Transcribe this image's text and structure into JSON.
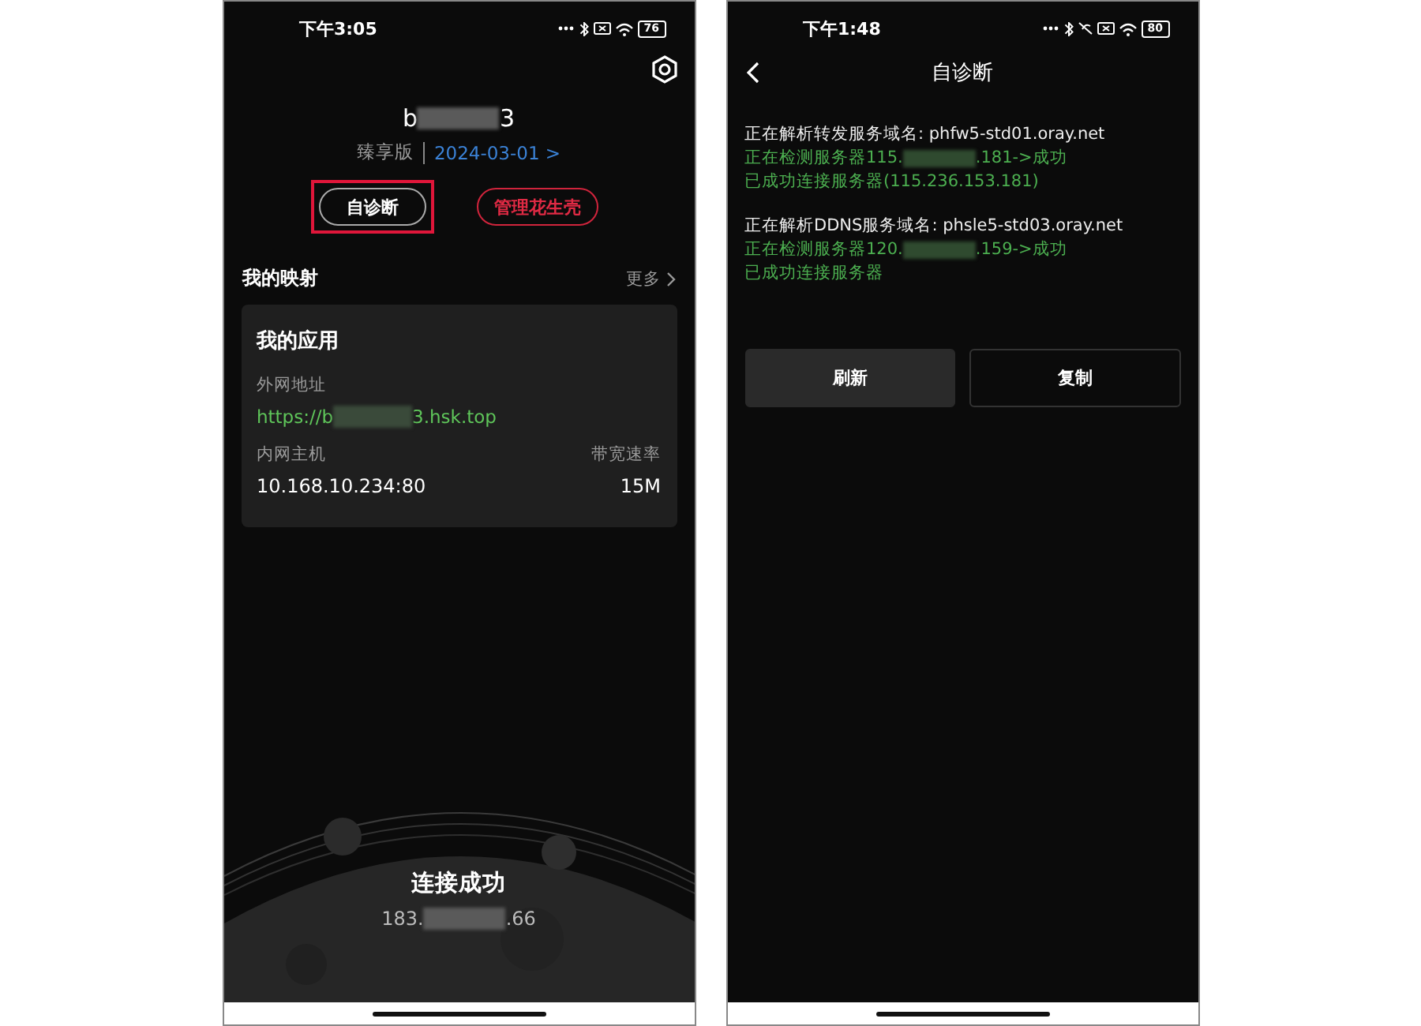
{
  "left_screen": {
    "status_bar": {
      "time": "下午3:05",
      "battery": "76"
    },
    "account": {
      "name_parts": [
        "b",
        "3"
      ],
      "edition": "臻享版",
      "expiry": "2024-03-01 >"
    },
    "buttons": [
      {
        "label": "自诊断",
        "kind": "outline",
        "highlighted": true
      },
      {
        "label": "管理花生壳",
        "kind": "danger",
        "highlighted": false
      }
    ],
    "section": {
      "title": "我的映射",
      "more": "更多"
    },
    "card": {
      "title": "我的应用",
      "url_label": "外网地址",
      "url_parts": [
        "https://b",
        "3.hsk.top"
      ],
      "host_label": "内网主机",
      "host": "10.168.10.234:80",
      "bandwidth_label": "带宽速率",
      "bandwidth": "15M"
    },
    "connection": {
      "status": "连接成功",
      "ip_parts": [
        "183.",
        ".66"
      ]
    }
  },
  "right_screen": {
    "status_bar": {
      "time": "下午1:48",
      "battery": "80"
    },
    "title": "自诊断",
    "log_blocks": [
      [
        {
          "kind": "info",
          "parts": [
            "正在解析转发服务域名: phfw5-std01.oray.net"
          ]
        },
        {
          "kind": "success",
          "parts": [
            "正在检测服务器115.",
            ".181->成功"
          ]
        },
        {
          "kind": "success",
          "parts": [
            "已成功连接服务器(115.236.153.181)"
          ]
        }
      ],
      [
        {
          "kind": "info",
          "parts": [
            "正在解析DDNS服务域名: phsle5-std03.oray.net"
          ]
        },
        {
          "kind": "success",
          "parts": [
            "正在检测服务器120.",
            ".159->成功"
          ]
        },
        {
          "kind": "success",
          "parts": [
            "已成功连接服务器"
          ]
        }
      ]
    ],
    "buttons": [
      {
        "label": "刷新",
        "kind": "filled"
      },
      {
        "label": "复制",
        "kind": "outline"
      }
    ]
  }
}
